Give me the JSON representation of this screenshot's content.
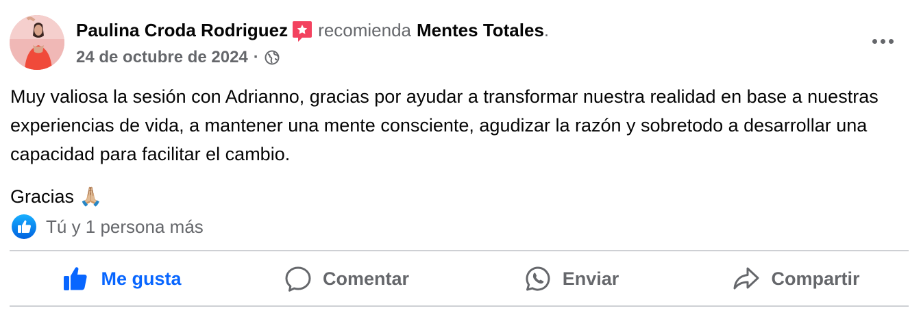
{
  "post": {
    "author": "Paulina Croda Rodriguez",
    "recommend_verb": "recomienda",
    "page_name": "Mentes Totales",
    "period": ".",
    "date": "24 de octubre de 2024",
    "separator": "·",
    "audience_icon": "globe-icon",
    "more_icon": "more-options-icon",
    "paragraphs": [
      "Muy valiosa la sesión con Adrianno, gracias por ayudar a transformar nuestra realidad en base a nuestras experiencias de vida, a mantener una mente consciente, agudizar la razón y sobretodo a desarrollar una capacidad para facilitar el cambio.",
      "Gracias 🙏🏼"
    ]
  },
  "reactions": {
    "icon": "like-reaction-icon",
    "summary": "Tú y 1 persona más"
  },
  "actions": [
    {
      "label": "Me gusta",
      "icon": "thumbs-up-icon",
      "active": true
    },
    {
      "label": "Comentar",
      "icon": "comment-icon",
      "active": false
    },
    {
      "label": "Enviar",
      "icon": "whatsapp-icon",
      "active": false
    },
    {
      "label": "Compartir",
      "icon": "share-icon",
      "active": false
    }
  ],
  "colors": {
    "text_primary": "#050505",
    "text_secondary": "#65676b",
    "accent_blue": "#0866ff",
    "recommend_badge": "#f3425f",
    "divider": "#ced0d4"
  }
}
